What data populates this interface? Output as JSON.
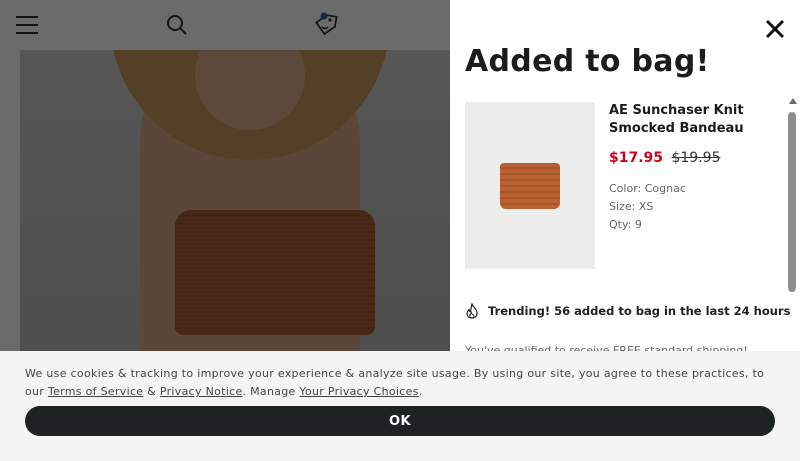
{
  "header": {
    "menu_icon": "hamburger-menu-icon",
    "search_icon": "search-icon",
    "offers_icon": "tag-offers-icon",
    "offers_badge_color": "#2b5fa8"
  },
  "drawer": {
    "title": "Added to bag!",
    "close_icon": "close-icon",
    "product": {
      "name": "AE Sunchaser Knit Smocked Bandeau",
      "sale_price": "$17.95",
      "original_price": "$19.95",
      "color_line": "Color: Cognac",
      "size_line": "Size: XS",
      "qty_line": "Qty: 9"
    },
    "trending": "Trending! 56 added to bag in the last 24 hours",
    "trending_icon": "flame-icon",
    "shipping_text": "You've qualified to receive FREE standard shipping!"
  },
  "cookie": {
    "text_before": "We use cookies & tracking to improve your experience & analyze site usage. By using our site, you agree to these practices, to our ",
    "terms_link": "Terms of Service",
    "amp": " & ",
    "privacy_link": "Privacy Notice",
    "text_middle": ". Manage ",
    "choices_link": "Your Privacy Choices",
    "text_end": ".",
    "ok_label": "OK"
  },
  "colors": {
    "sale_price": "#d0021b",
    "ok_button": "#1f2223",
    "overlay": "rgba(0,0,0,0.58)"
  }
}
